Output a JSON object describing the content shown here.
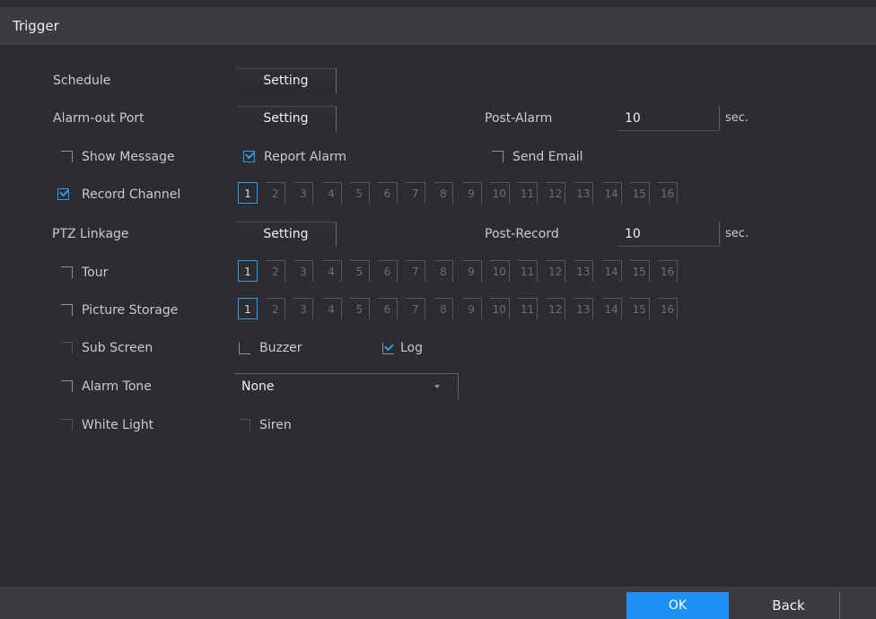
{
  "window": {
    "title": "Trigger"
  },
  "schedule": {
    "label": "Schedule",
    "button": "Setting"
  },
  "alarm_out": {
    "label": "Alarm-out Port",
    "button": "Setting",
    "post_label": "Post-Alarm",
    "post_value": "10",
    "unit": "sec."
  },
  "show_message": {
    "label": "Show Message",
    "checked": false
  },
  "report_alarm": {
    "label": "Report Alarm",
    "checked": true
  },
  "send_email": {
    "label": "Send Email",
    "checked": false
  },
  "record_channel": {
    "label": "Record Channel",
    "checked": true
  },
  "ptz": {
    "label": "PTZ Linkage",
    "button": "Setting",
    "post_label": "Post-Record",
    "post_value": "10",
    "unit": "sec."
  },
  "tour": {
    "label": "Tour",
    "checked": false
  },
  "picture_storage": {
    "label": "Picture Storage",
    "checked": false
  },
  "sub_screen": {
    "label": "Sub Screen",
    "checked": false
  },
  "buzzer": {
    "label": "Buzzer",
    "checked": false
  },
  "log": {
    "label": "Log",
    "checked": true
  },
  "alarm_tone": {
    "label": "Alarm Tone",
    "checked": false,
    "value": "None"
  },
  "white_light": {
    "label": "White Light",
    "checked": false
  },
  "siren": {
    "label": "Siren",
    "checked": false
  },
  "channels": [
    "1",
    "2",
    "3",
    "4",
    "5",
    "6",
    "7",
    "8",
    "9",
    "10",
    "11",
    "12",
    "13",
    "14",
    "15",
    "16"
  ],
  "selected_channel": "1",
  "footer": {
    "ok": "OK",
    "back": "Back"
  },
  "colors": {
    "accent": "#1e90f5",
    "background": "#2c2d31",
    "titlebar": "#3b3c41"
  }
}
